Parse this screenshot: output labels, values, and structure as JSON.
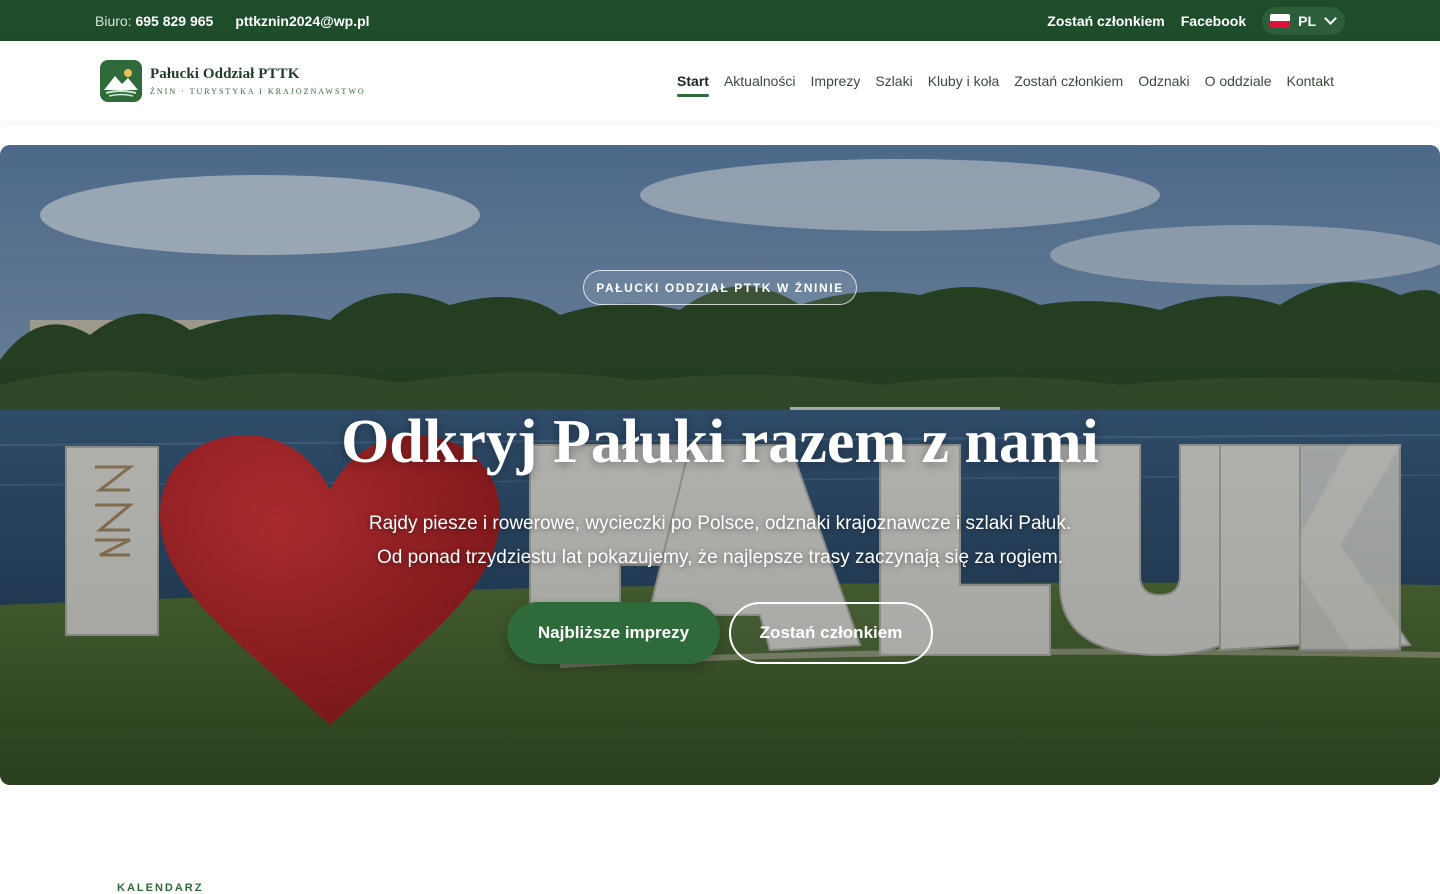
{
  "topbar": {
    "office_label": "Biuro:",
    "phone": "695 829 965",
    "email": "pttkznin2024@wp.pl",
    "join_link": "Zostań członkiem",
    "facebook_link": "Facebook",
    "language": "PL"
  },
  "brand": {
    "name": "Pałucki Oddział PTTK",
    "tagline": "Żnin · Turystyka i Krajoznawstwo"
  },
  "nav": {
    "items": [
      {
        "label": "Start"
      },
      {
        "label": "Aktualności"
      },
      {
        "label": "Imprezy"
      },
      {
        "label": "Szlaki"
      },
      {
        "label": "Kluby i koła"
      },
      {
        "label": "Zostań członkiem"
      },
      {
        "label": "Odznaki"
      },
      {
        "label": "O oddziale"
      },
      {
        "label": "Kontakt"
      }
    ],
    "active": "Start"
  },
  "hero": {
    "eyebrow": "PAŁUCKI ODDZIAŁ PTTK W ŻNINIE",
    "title": "Odkryj Pałuki razem z nami",
    "lead_line1": "Rajdy piesze i rowerowe, wycieczki po Polsce, odznaki krajoznawcze i szlaki Pałuk.",
    "lead_line2": "Od ponad trzydziestu lat pokazujemy, że najlepsze trasy zaczynają się za rogiem.",
    "primary_button": "Najbliższe imprezy",
    "secondary_button": "Zostań członkiem",
    "sign_text": "PAŁUKI"
  },
  "section": {
    "eyebrow": "KALENDARZ"
  },
  "colors": {
    "topbar_bg": "#1f4d2b",
    "accent": "#2f6a3a",
    "heart": "#c8282c"
  },
  "icons": {
    "flag": "poland-flag-icon",
    "chevron": "chevron-down-icon",
    "logo": "mountain-lake-logo-icon"
  }
}
